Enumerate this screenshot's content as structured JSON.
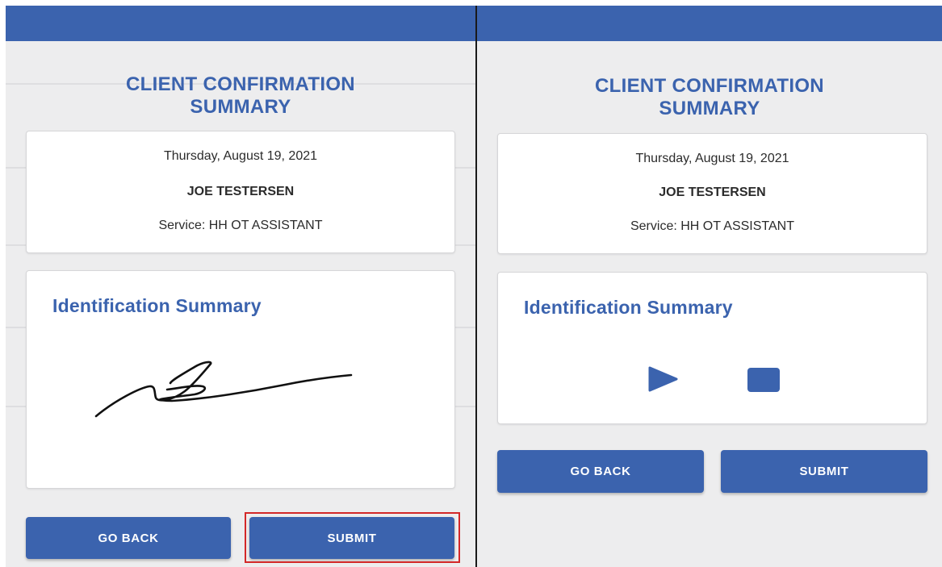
{
  "left_screen": {
    "title_line1": "CLIENT CONFIRMATION",
    "title_line2": "SUMMARY",
    "summary_card": {
      "date": "Thursday, August 19, 2021",
      "client_name": "JOE TESTERSEN",
      "service": "Service: HH OT ASSISTANT"
    },
    "identification": {
      "heading": "Identification Summary",
      "content_type": "signature"
    },
    "buttons": {
      "go_back": "GO BACK",
      "submit": "SUBMIT"
    },
    "highlighted_element": "submit-button"
  },
  "right_screen": {
    "title_line1": "CLIENT CONFIRMATION",
    "title_line2": "SUMMARY",
    "summary_card": {
      "date": "Thursday, August 19, 2021",
      "client_name": "JOE TESTERSEN",
      "service": "Service: HH OT ASSISTANT"
    },
    "identification": {
      "heading": "Identification Summary",
      "content_type": "audio",
      "controls": [
        "play-icon",
        "stop-icon"
      ]
    },
    "buttons": {
      "go_back": "GO BACK",
      "submit": "SUBMIT"
    }
  },
  "colors": {
    "brand_blue": "#3b63ae",
    "background": "#ededee",
    "card": "#ffffff",
    "highlight": "#d32828"
  }
}
